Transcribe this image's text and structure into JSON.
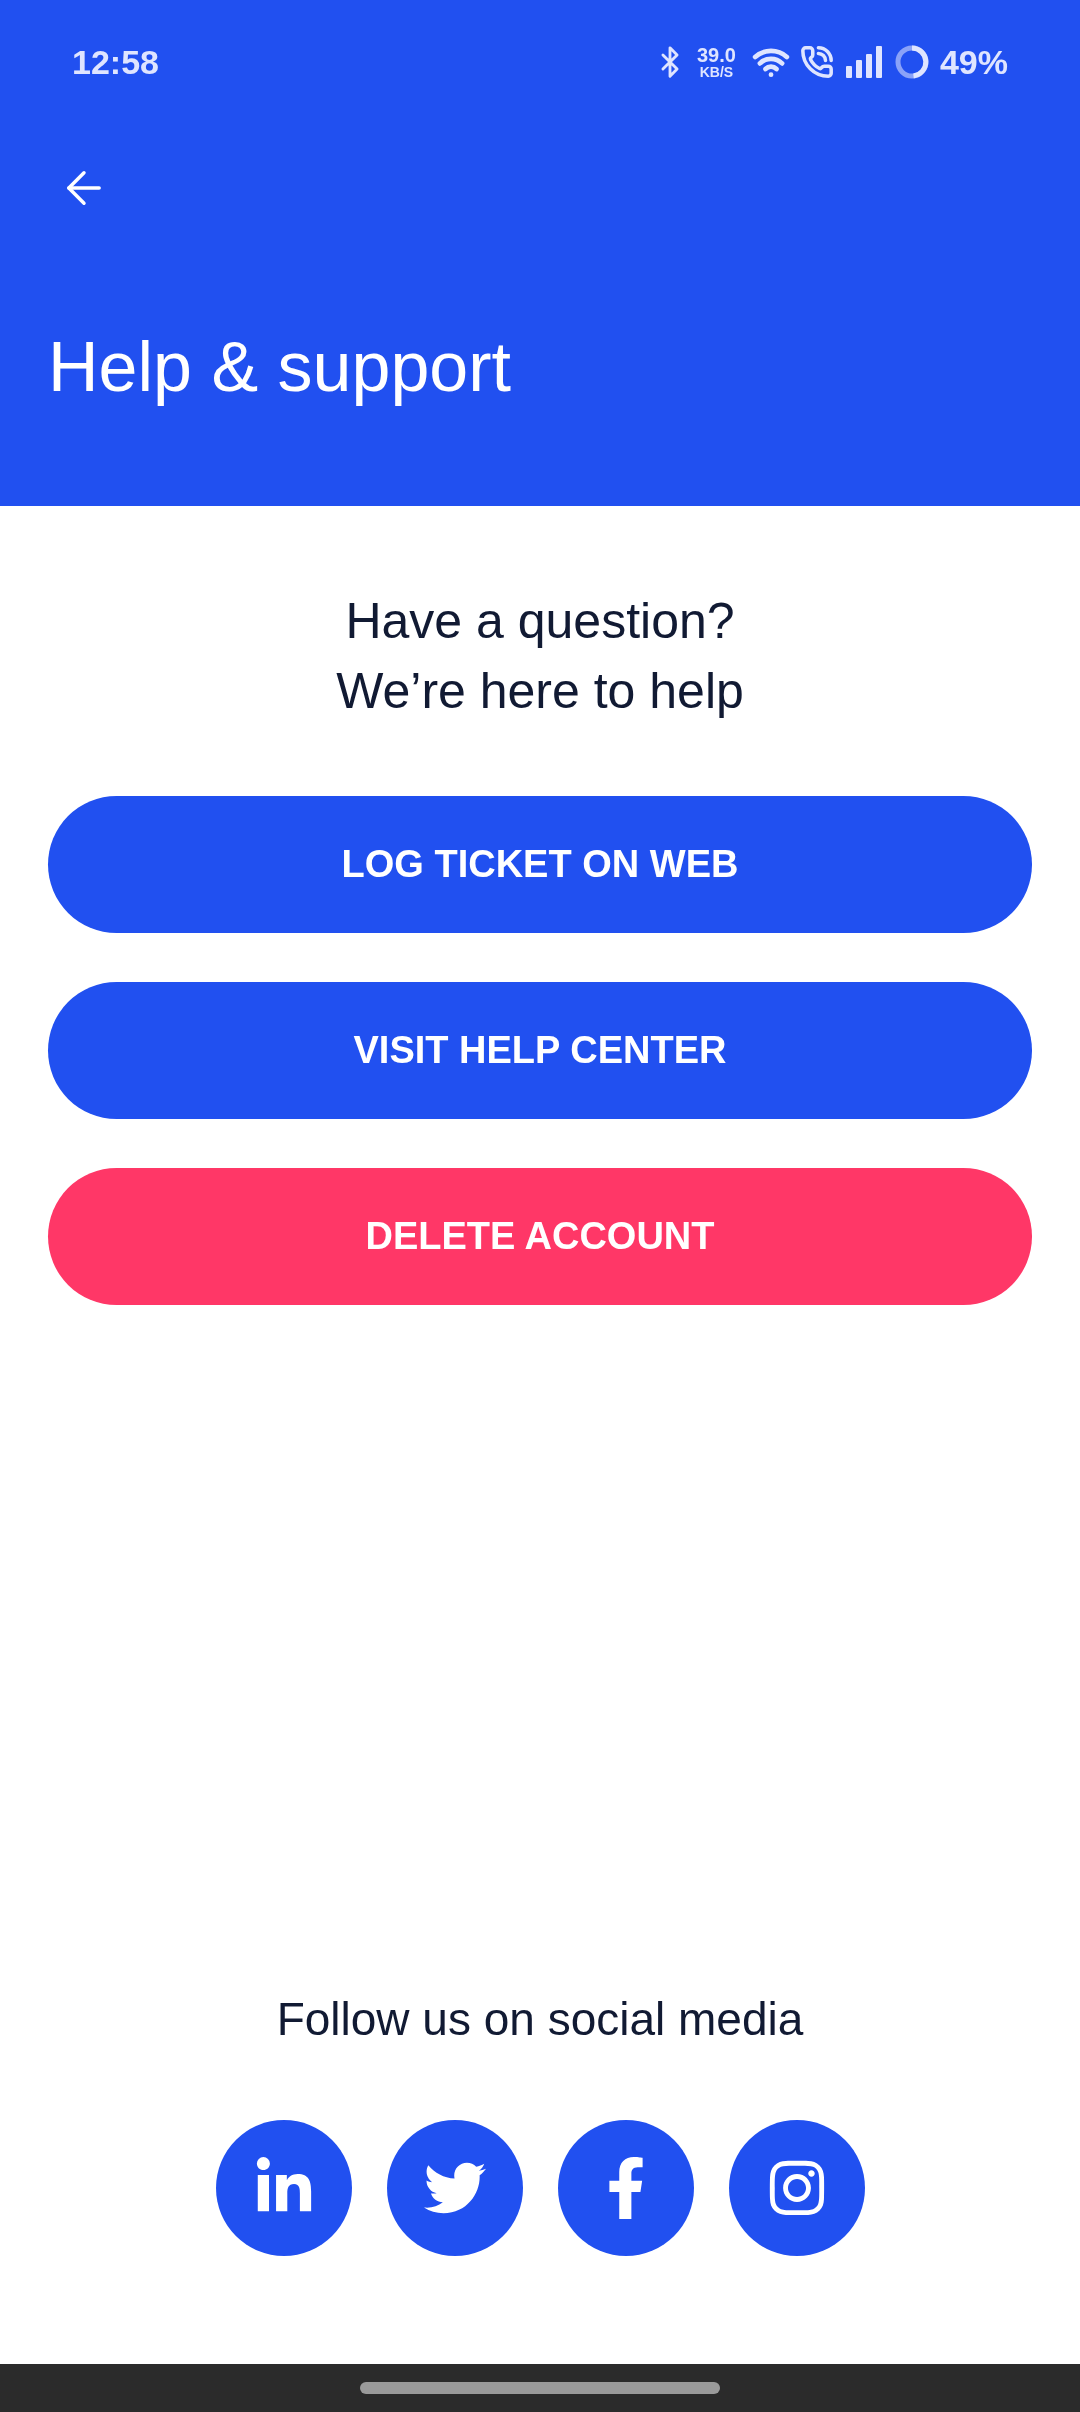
{
  "status_bar": {
    "time": "12:58",
    "speed_value": "39.0",
    "speed_unit": "KB/S",
    "battery": "49%"
  },
  "header": {
    "title": "Help & support"
  },
  "intro": [
    "Have a question?",
    "We’re here to help"
  ],
  "buttons": [
    {
      "label": "LOG TICKET ON WEB",
      "kind": "primary"
    },
    {
      "label": "VISIT HELP CENTER",
      "kind": "primary"
    },
    {
      "label": "DELETE ACCOUNT",
      "kind": "danger"
    }
  ],
  "social": {
    "heading": "Follow us on social media",
    "links": [
      {
        "kind": "linkedin"
      },
      {
        "kind": "twitter"
      },
      {
        "kind": "facebook"
      },
      {
        "kind": "instagram"
      }
    ]
  }
}
